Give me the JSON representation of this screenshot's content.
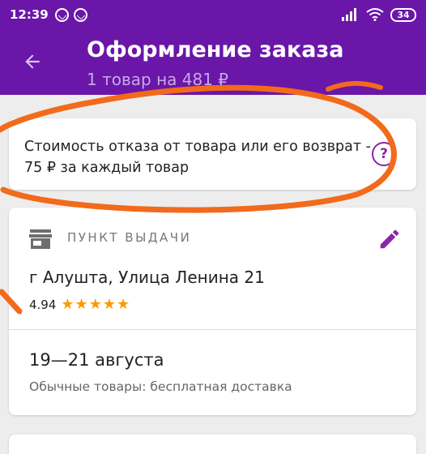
{
  "status_bar": {
    "time": "12:39",
    "battery": "34",
    "icons": [
      "viber-icon",
      "viber-icon",
      "signal-icon",
      "wifi-icon",
      "battery-icon"
    ]
  },
  "app_bar": {
    "title": "Оформление заказа",
    "subtitle": "1 товар на 481 ₽",
    "back_icon": "arrow-back-icon"
  },
  "notice": {
    "text": "Стоимость отказа от товара или его возврат - 75 ₽ за каждый товар",
    "help_icon": "question-circle-icon",
    "help_glyph": "?"
  },
  "pickup": {
    "label": "ПУНКТ ВЫДАЧИ",
    "address": "г Алушта, Улица Ленина 21",
    "rating": "4.94",
    "stars": 5,
    "dates": "19—21 августа",
    "delivery_note": "Обычные товары: бесплатная доставка",
    "edit_icon": "pencil-icon",
    "store_icon": "store-icon"
  },
  "colors": {
    "brand": "#6a16a8",
    "accent": "#8e24aa",
    "star": "#ff9800",
    "annotation": "#f26a1b"
  }
}
